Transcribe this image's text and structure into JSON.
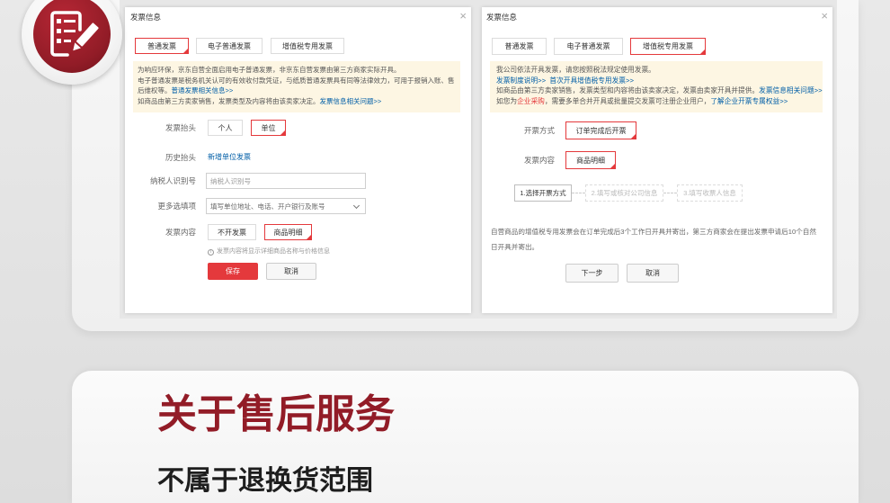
{
  "colors": {
    "brand": "#921c27",
    "accent": "#e4393c",
    "link": "#005ea7",
    "notice_bg": "#fdf6e3"
  },
  "badge": {
    "icon": "invoice-edit-icon"
  },
  "left_dialog": {
    "title": "发票信息",
    "close_icon": "close-icon",
    "tabs": [
      {
        "label": "普通发票",
        "selected": true
      },
      {
        "label": "电子普通发票",
        "selected": false
      },
      {
        "label": "增值税专用发票",
        "selected": false
      }
    ],
    "notice": {
      "line1": "为响应环保，京东自营全面启用电子普通发票，非京东自营发票由第三方商家实际开具。",
      "line2": "电子普通发票是税务机关认可的有效收付款凭证，与纸质普通发票具有同等法律效力，可用于报销入账、售",
      "line3_text": "后维权等。",
      "line3_link": "普通发票相关信息>>",
      "line4_text": "如商品由第三方卖家销售，发票类型及内容将由该卖家决定。",
      "line4_link": "发票信息相关问题>>"
    },
    "form": {
      "title_type": {
        "label": "发票抬头",
        "options": [
          {
            "label": "个人",
            "selected": false
          },
          {
            "label": "单位",
            "selected": true
          }
        ]
      },
      "history": {
        "label": "历史抬头",
        "link": "新增单位发票"
      },
      "tax_id": {
        "label": "纳税人识别号",
        "placeholder": "纳税人识别号"
      },
      "optional": {
        "label": "更多选填项",
        "value": "填写单位地址、电话、开户银行及账号"
      },
      "content": {
        "label": "发票内容",
        "options": [
          {
            "label": "不开发票",
            "selected": false
          },
          {
            "label": "商品明细",
            "selected": true
          }
        ]
      },
      "hint": "发票内容将显示详细商品名称与价格信息"
    },
    "buttons": {
      "save": "保存",
      "cancel": "取消"
    }
  },
  "right_dialog": {
    "title": "发票信息",
    "close_icon": "close-icon",
    "tabs": [
      {
        "label": "普通发票",
        "selected": false
      },
      {
        "label": "电子普通发票",
        "selected": false
      },
      {
        "label": "增值税专用发票",
        "selected": true
      }
    ],
    "notice": {
      "line1": "我公司依法开具发票，请您按照税法规定使用发票。",
      "line2_link1": "发票制度说明>>",
      "line2_link2": "首次开具增值税专用发票>>",
      "line3_text": "如商品由第三方卖家销售，发票类型和内容将由该卖家决定，发票由卖家开具并提供。",
      "line3_link": "发票信息相关问题>>",
      "line4_text1": "如您为",
      "line4_highlight": "企业采购",
      "line4_text2": "，需要多单合并开具或批量提交发票可注册企业用户，",
      "line4_link": "了解企业开票专属权益>>"
    },
    "form": {
      "method": {
        "label": "开票方式",
        "option": {
          "label": "订单完成后开票",
          "selected": true
        }
      },
      "content": {
        "label": "发票内容",
        "option": {
          "label": "商品明细",
          "selected": true
        }
      }
    },
    "steps": [
      {
        "label": "1.选择开票方式",
        "active": true
      },
      {
        "label": "2.填写或核对公司信息",
        "active": false
      },
      {
        "label": "3.填写收票人信息",
        "active": false
      }
    ],
    "note_line1": "自营商品的增值税专用发票会在订单完成后3个工作日开具并寄出，第三方商家会在提出发票申请后10个自然",
    "note_line2": "日开具并寄出。",
    "buttons": {
      "next": "下一步",
      "cancel": "取消"
    }
  },
  "section": {
    "title": "关于售后服务",
    "subtitle": "不属于退换货范围"
  }
}
